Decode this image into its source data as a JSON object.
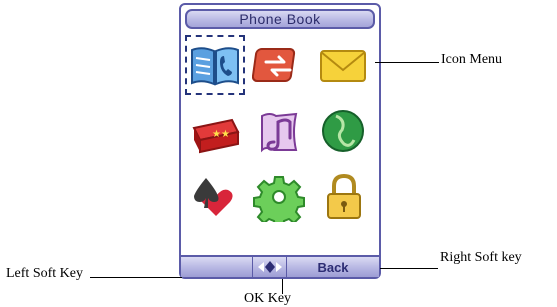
{
  "screen": {
    "title": "Phone Book",
    "icons": [
      {
        "name": "phonebook-icon",
        "selected": true
      },
      {
        "name": "call-transfer-icon",
        "selected": false
      },
      {
        "name": "message-envelope-icon",
        "selected": false
      },
      {
        "name": "gift-box-icon",
        "selected": false
      },
      {
        "name": "music-note-icon",
        "selected": false
      },
      {
        "name": "internet-globe-icon",
        "selected": false
      },
      {
        "name": "games-heart-spade-icon",
        "selected": false
      },
      {
        "name": "settings-gear-icon",
        "selected": false
      },
      {
        "name": "security-lock-icon",
        "selected": false
      }
    ],
    "softkeys": {
      "left_label": "",
      "ok_label": "◆",
      "right_label": "Back"
    }
  },
  "callouts": {
    "icon_menu": "Icon Menu",
    "left_soft_key": "Left Soft Key",
    "right_soft_key": "Right Soft key",
    "ok_key": "OK Key"
  },
  "colors": {
    "frame": "#5b5ba8",
    "title_text": "#2c2c6a",
    "selection": "#24337a"
  }
}
